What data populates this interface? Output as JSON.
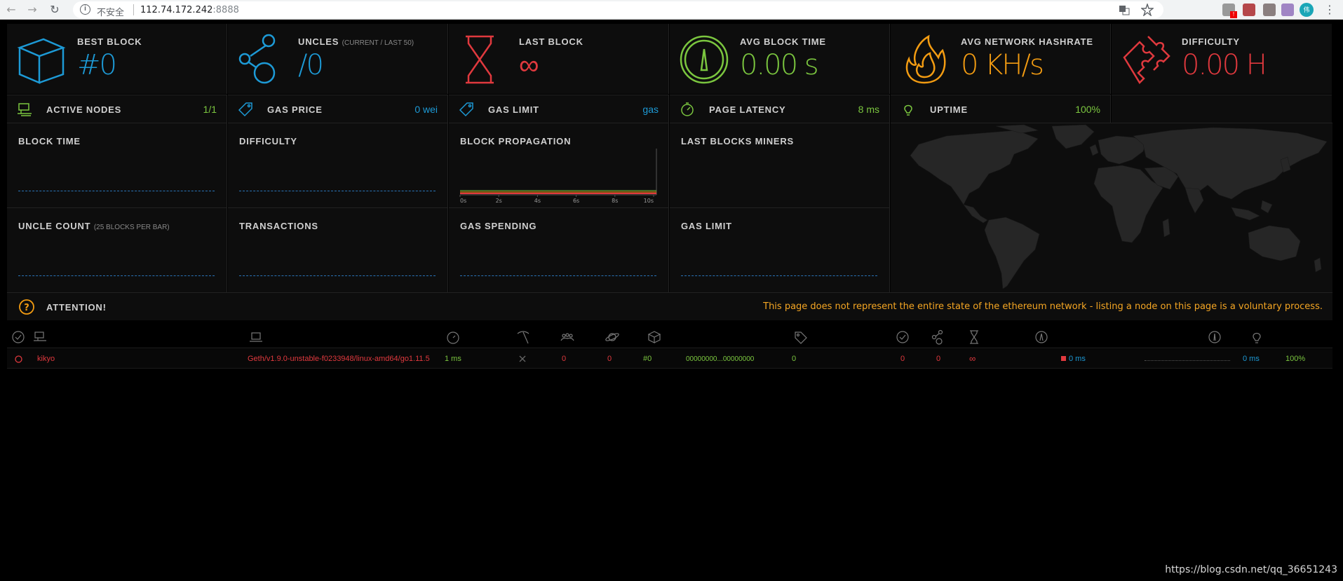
{
  "browser": {
    "security_label": "不安全",
    "url_host": "112.74.172.242",
    "url_port": ":8888",
    "avatar_initial": "伟"
  },
  "stats_big": [
    {
      "label": "BEST BLOCK",
      "sub": "",
      "value": "#0",
      "color": "#1d9ad6",
      "icon": "cube-icon"
    },
    {
      "label": "UNCLES",
      "sub": "(CURRENT / LAST 50)",
      "value": "/0",
      "color": "#1d9ad6",
      "icon": "uncles-icon"
    },
    {
      "label": "LAST BLOCK",
      "sub": "",
      "value": "∞",
      "color": "#e0393e",
      "icon": "hourglass-icon"
    },
    {
      "label": "AVG BLOCK TIME",
      "sub": "",
      "value": "0.00 s",
      "color": "#7bc63f",
      "icon": "gauge-icon"
    },
    {
      "label": "AVG NETWORK HASHRATE",
      "sub": "",
      "value": "0 KH/s",
      "color": "#f39c12",
      "icon": "flame-icon"
    },
    {
      "label": "DIFFICULTY",
      "sub": "",
      "value": "0.00 H",
      "color": "#e0393e",
      "icon": "puzzle-icon"
    }
  ],
  "stats_small": [
    {
      "label": "ACTIVE NODES",
      "value": "1/1",
      "color": "#7bc63f",
      "icon": "nodes-icon"
    },
    {
      "label": "GAS PRICE",
      "value": "0 wei",
      "color": "#1d9ad6",
      "icon": "tag-icon"
    },
    {
      "label": "GAS LIMIT",
      "value": "gas",
      "color": "#1d9ad6",
      "icon": "tag-icon"
    },
    {
      "label": "PAGE LATENCY",
      "value": "8 ms",
      "color": "#7bc63f",
      "icon": "timer-icon"
    },
    {
      "label": "UPTIME",
      "value": "100%",
      "color": "#7bc63f",
      "icon": "bulb-icon"
    }
  ],
  "charts": [
    {
      "label": "BLOCK TIME",
      "sub": ""
    },
    {
      "label": "DIFFICULTY",
      "sub": ""
    },
    {
      "label": "BLOCK PROPAGATION",
      "sub": ""
    },
    {
      "label": "LAST BLOCKS MINERS",
      "sub": ""
    },
    {
      "label": "UNCLE COUNT",
      "sub": "(25 BLOCKS PER BAR)"
    },
    {
      "label": "TRANSACTIONS",
      "sub": ""
    },
    {
      "label": "GAS SPENDING",
      "sub": ""
    },
    {
      "label": "GAS LIMIT",
      "sub": ""
    }
  ],
  "propagation_ticks": [
    "0s",
    "2s",
    "4s",
    "6s",
    "8s",
    "10s"
  ],
  "attention": {
    "label": "ATTENTION!",
    "message": "This page does not represent the entire state of the ethereum network - listing a node on this page is a voluntary process."
  },
  "node_row": {
    "name": "kikyo",
    "client": "Geth/v1.9.0-unstable-f0233948/linux-amd64/go1.11.5",
    "latency": "1 ms",
    "peers": "0",
    "pending": "0",
    "block": "#0",
    "hash": "00000000...00000000",
    "difficulty": "0",
    "transactions": "0",
    "uncles": "0",
    "last_block": "∞",
    "propagation": "0 ms",
    "avg_propagation": "0 ms",
    "uptime": "100%"
  },
  "watermark": "https://blog.csdn.net/qq_36651243"
}
